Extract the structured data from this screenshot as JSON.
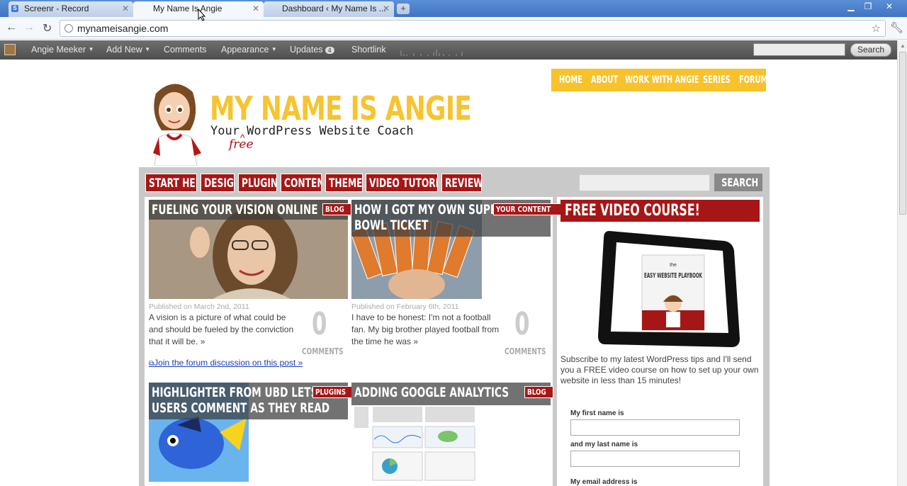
{
  "browser": {
    "tabs": [
      {
        "title": "Screenr - Record"
      },
      {
        "title": "My Name Is Angie"
      },
      {
        "title": "Dashboard ‹ My Name Is ..."
      }
    ],
    "url": "mynameisangie.com"
  },
  "adminbar": {
    "user": "Angie Meeker",
    "add_new": "Add New",
    "comments": "Comments",
    "appearance": "Appearance",
    "updates": "Updates",
    "updates_count": "4",
    "shortlink": "Shortlink",
    "search_button": "Search"
  },
  "site": {
    "logo_title": "MY NAME IS ANGIE",
    "logo_tagline": "Your WordPress Website Coach",
    "logo_free": "free",
    "top_nav": [
      "HOME",
      "ABOUT",
      "WORK WITH ANGIE",
      "SERIES",
      "FORUM"
    ],
    "categories": [
      "START HERE",
      "DESIGN",
      "PLUGINS",
      "CONTENT",
      "THEMES",
      "VIDEO TUTORIALS",
      "REVIEWS"
    ],
    "search_button": "SEARCH"
  },
  "posts": [
    {
      "title": "FUELING YOUR VISION ONLINE",
      "tag": "BLOG",
      "date": "Published on March 2nd, 2011",
      "excerpt": "A vision is a picture of what could be and should be fueled by the conviction that it will be.",
      "more": "»",
      "comments": "0",
      "comments_label": "COMMENTS"
    },
    {
      "title_line1": "HOW I GOT MY OWN SUPER",
      "title_line2": "BOWL TICKET",
      "tag": "YOUR CONTENT",
      "date": "Published on February 6th, 2011",
      "excerpt": "I have to be honest: I'm not a football fan. My big brother played football from the time he was",
      "more": "»",
      "comments": "0",
      "comments_label": "COMMENTS"
    },
    {
      "title_line1": "HIGHLIGHTER FROM UBD LETS",
      "title_line2": "USERS COMMENT AS THEY READ",
      "tag": "PLUGINS"
    },
    {
      "title": "ADDING GOOGLE ANALYTICS",
      "tag": "BLOG"
    }
  ],
  "forum_link": "Join the forum discussion on this post »",
  "sidebar": {
    "heading": "FREE VIDEO COURSE!",
    "book_title_small": "the",
    "book_title": "EASY WEBSITE PLAYBOOK",
    "text": "Subscribe to my latest WordPress tips and I'll send you a FREE video course on how to set up your own website in less than 15 minutes!",
    "first_name_label": "My first name is",
    "last_name_label": "and my last name is",
    "email_label": "My email address is"
  },
  "colors": {
    "brand_yellow": "#f8c22b",
    "brand_red": "#a71616"
  }
}
